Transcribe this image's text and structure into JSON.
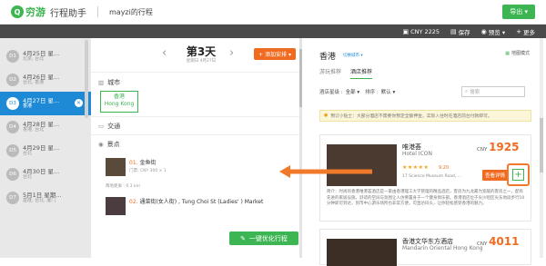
{
  "header": {
    "logo_mark": "Q",
    "logo_text": "穷游",
    "app_title": "行程助手",
    "trip_name": "mayzi的行程",
    "export_label": "导出 ▾"
  },
  "toolbar": {
    "currency": "CNY 2225",
    "save": "保存",
    "preview": "预览 ▾",
    "more": "更多"
  },
  "sidebar": {
    "days": [
      {
        "badge": "D1",
        "date": "4月25日 星...",
        "place": "北京, 台北",
        "active": false
      },
      {
        "badge": "D2",
        "date": "4月26日 星...",
        "place": "台北, 香港",
        "active": false
      },
      {
        "badge": "D3",
        "date": "4月27日 星...",
        "place": "香港",
        "active": true
      },
      {
        "badge": "D4",
        "date": "4月28日 星...",
        "place": "香港, 台北",
        "active": false
      },
      {
        "badge": "D5",
        "date": "4月29日 星...",
        "place": "台北",
        "active": false
      },
      {
        "badge": "D6",
        "date": "4月30日 星...",
        "place": "台北",
        "active": false
      },
      {
        "badge": "D7",
        "date": "5月1日 星期...",
        "place": "基隆, 台北, 厦门",
        "active": false
      }
    ],
    "delete_glyph": "×"
  },
  "dayplan": {
    "title": "第3天",
    "date": "星期日 4月27日",
    "add_label": "+ 添加安排 ▾",
    "city_section": "城市",
    "city_tag_cn": "香港",
    "city_tag_en": "Hong Kong",
    "traffic_section": "交通",
    "poi_section": "景点",
    "pois": [
      {
        "num": "01.",
        "name": "金鱼街",
        "meta": "门票: CNY 300 × 1"
      },
      {
        "num": "02.",
        "name": "通菜街(女人街) , Tung Choi St (Ladies' ) Market",
        "meta": ""
      }
    ],
    "distance_label": "两地距离 : 0.3 km",
    "optimize_label": "一键优化行程"
  },
  "panel": {
    "city": "香港",
    "switch_city": "切换城市 ▾",
    "map_mode": "地图模式",
    "tabs": [
      "游玩推荐",
      "酒店推荐"
    ],
    "filter_star_label": "酒店星级 :",
    "filter_star_value": "全部 ▾",
    "filter_sort_label": "排序 :",
    "filter_sort_value": "默认 ▾",
    "search_placeholder": "搜索",
    "tip": "预订小贴士：大部分酒店不需要你预定全额押金，实际入住时在酒店前台付款即可。",
    "hotels": [
      {
        "name_cn": "唯港荟",
        "name_en": "Hotel ICON",
        "stars": "★★★★★",
        "score": "9.20",
        "address": "17 Science Museum Road, ...",
        "price_prefix": "CNY",
        "price": "1925",
        "view_label": "查看详情",
        "add_glyph": "+",
        "desc": "简介：时尚的香港唯港荟酒店是一家由香港理工大学管理的精品酒店，客房为九龙最为宽敞的客房之一，配有先进的家居设施，舒适的空间与氛围让人仿佛置身于一个健身俱乐部。香港酒店位于尖沙咀区尖东地段步行10分钟即可到达，到市中心游乐场所也非常方便，可直达码头，让你轻松感受香港的魅力。"
      },
      {
        "name_cn": "香港文华东方酒店",
        "name_en": "Mandarin Oriental Hong Kong",
        "price_prefix": "CNY",
        "price": "4011"
      }
    ]
  }
}
